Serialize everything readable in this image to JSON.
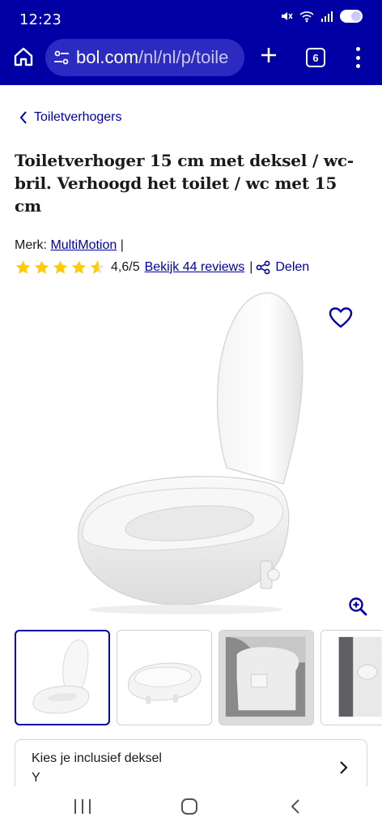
{
  "status_bar": {
    "time": "12:23"
  },
  "browser": {
    "url_host": "bol.com",
    "url_path": "/nl/nl/p/toile",
    "tab_count": "6"
  },
  "breadcrumb": {
    "label": "Toiletverhogers"
  },
  "product": {
    "title": "Toiletverhoger 15 cm met deksel / wc-bril. Verhoogd het toilet / wc met 15 cm",
    "brand_prefix": "Merk:",
    "brand": "MultiMotion",
    "brand_sep": "|",
    "rating": 4.6,
    "rating_text": "4,6/5",
    "reviews_link": "Bekijk 44 reviews",
    "action_sep": "|",
    "share_label": "Delen"
  },
  "option": {
    "label": "Kies je inclusief deksel",
    "value": "Y"
  },
  "colors": {
    "brand_blue": "#0000a4",
    "star_yellow": "#ffcc00"
  },
  "icons": [
    "home-icon",
    "tune-icon",
    "plus-icon",
    "tabs-icon",
    "more-vert-icon",
    "chevron-left-icon",
    "star-icon",
    "share-icon",
    "heart-icon",
    "zoom-in-icon",
    "chevron-right-icon"
  ]
}
